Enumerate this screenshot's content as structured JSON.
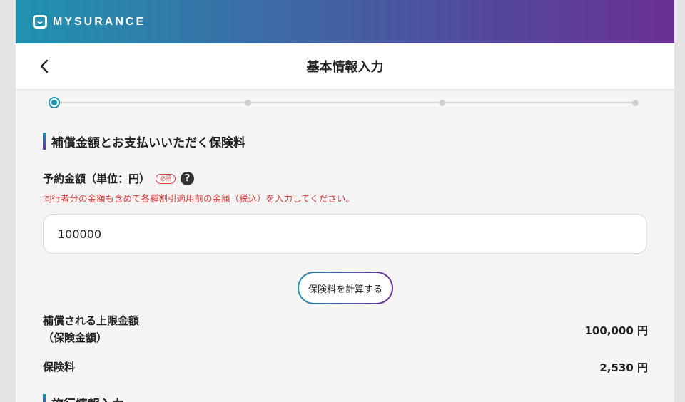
{
  "brand": {
    "name": "MYSURANCE"
  },
  "header": {
    "title": "基本情報入力",
    "back_icon": "chevron-left-icon"
  },
  "progress": {
    "total_steps": 4,
    "current_step": 1
  },
  "section": {
    "heading": "補償金額とお支払いいただく保険料"
  },
  "reservation": {
    "label": "予約金額（単位：円）",
    "required_badge": "必須",
    "help_icon": "?",
    "note": "同行者分の金額も含めて各種割引適用前の金額（税込）を入力してください。",
    "value": "100000"
  },
  "calculate_button": {
    "label": "保険料を計算する"
  },
  "results": {
    "coverage_label_line1": "補償される上限金額",
    "coverage_label_line2": "（保険金額）",
    "coverage_value": "100,000 円",
    "premium_label": "保険料",
    "premium_value": "2,530 円"
  },
  "next_section": {
    "heading": "旅行情報入力"
  },
  "colors": {
    "accent_start": "#1f93b0",
    "accent_end": "#6a3094",
    "required_red": "#d73a3a"
  }
}
